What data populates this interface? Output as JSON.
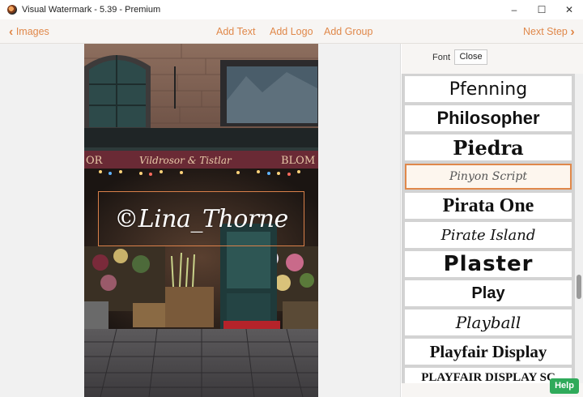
{
  "window": {
    "title": "Visual Watermark - 5.39 - Premium",
    "minimize": "–",
    "maximize": "☐",
    "close": "✕"
  },
  "toolbar": {
    "back_label": "Images",
    "add_text": "Add Text",
    "add_logo": "Add Logo",
    "add_group": "Add Group",
    "next_label": "Next Step",
    "accent_color": "#e0884a"
  },
  "photo": {
    "sign_left": "OR",
    "sign_text": "Vildrosor & Tistlar",
    "sign_right": "BLOM"
  },
  "watermark": {
    "text": "©Lina_Thorne",
    "border_color": "#d9804a"
  },
  "panel": {
    "font_label": "Font",
    "close_label": "Close",
    "fonts": [
      {
        "label": "Pfenning",
        "selected": false
      },
      {
        "label": "Philosopher",
        "selected": false
      },
      {
        "label": "Piedra",
        "selected": false
      },
      {
        "label": "Pinyon Script",
        "selected": true
      },
      {
        "label": "Pirata One",
        "selected": false
      },
      {
        "label": "Pirate Island",
        "selected": false
      },
      {
        "label": "Plaster",
        "selected": false
      },
      {
        "label": "Play",
        "selected": false
      },
      {
        "label": "Playball",
        "selected": false
      },
      {
        "label": "Playfair Display",
        "selected": false
      },
      {
        "label": "PLAYFAIR DISPLAY SC",
        "selected": false
      }
    ]
  },
  "help": {
    "label": "Help"
  }
}
